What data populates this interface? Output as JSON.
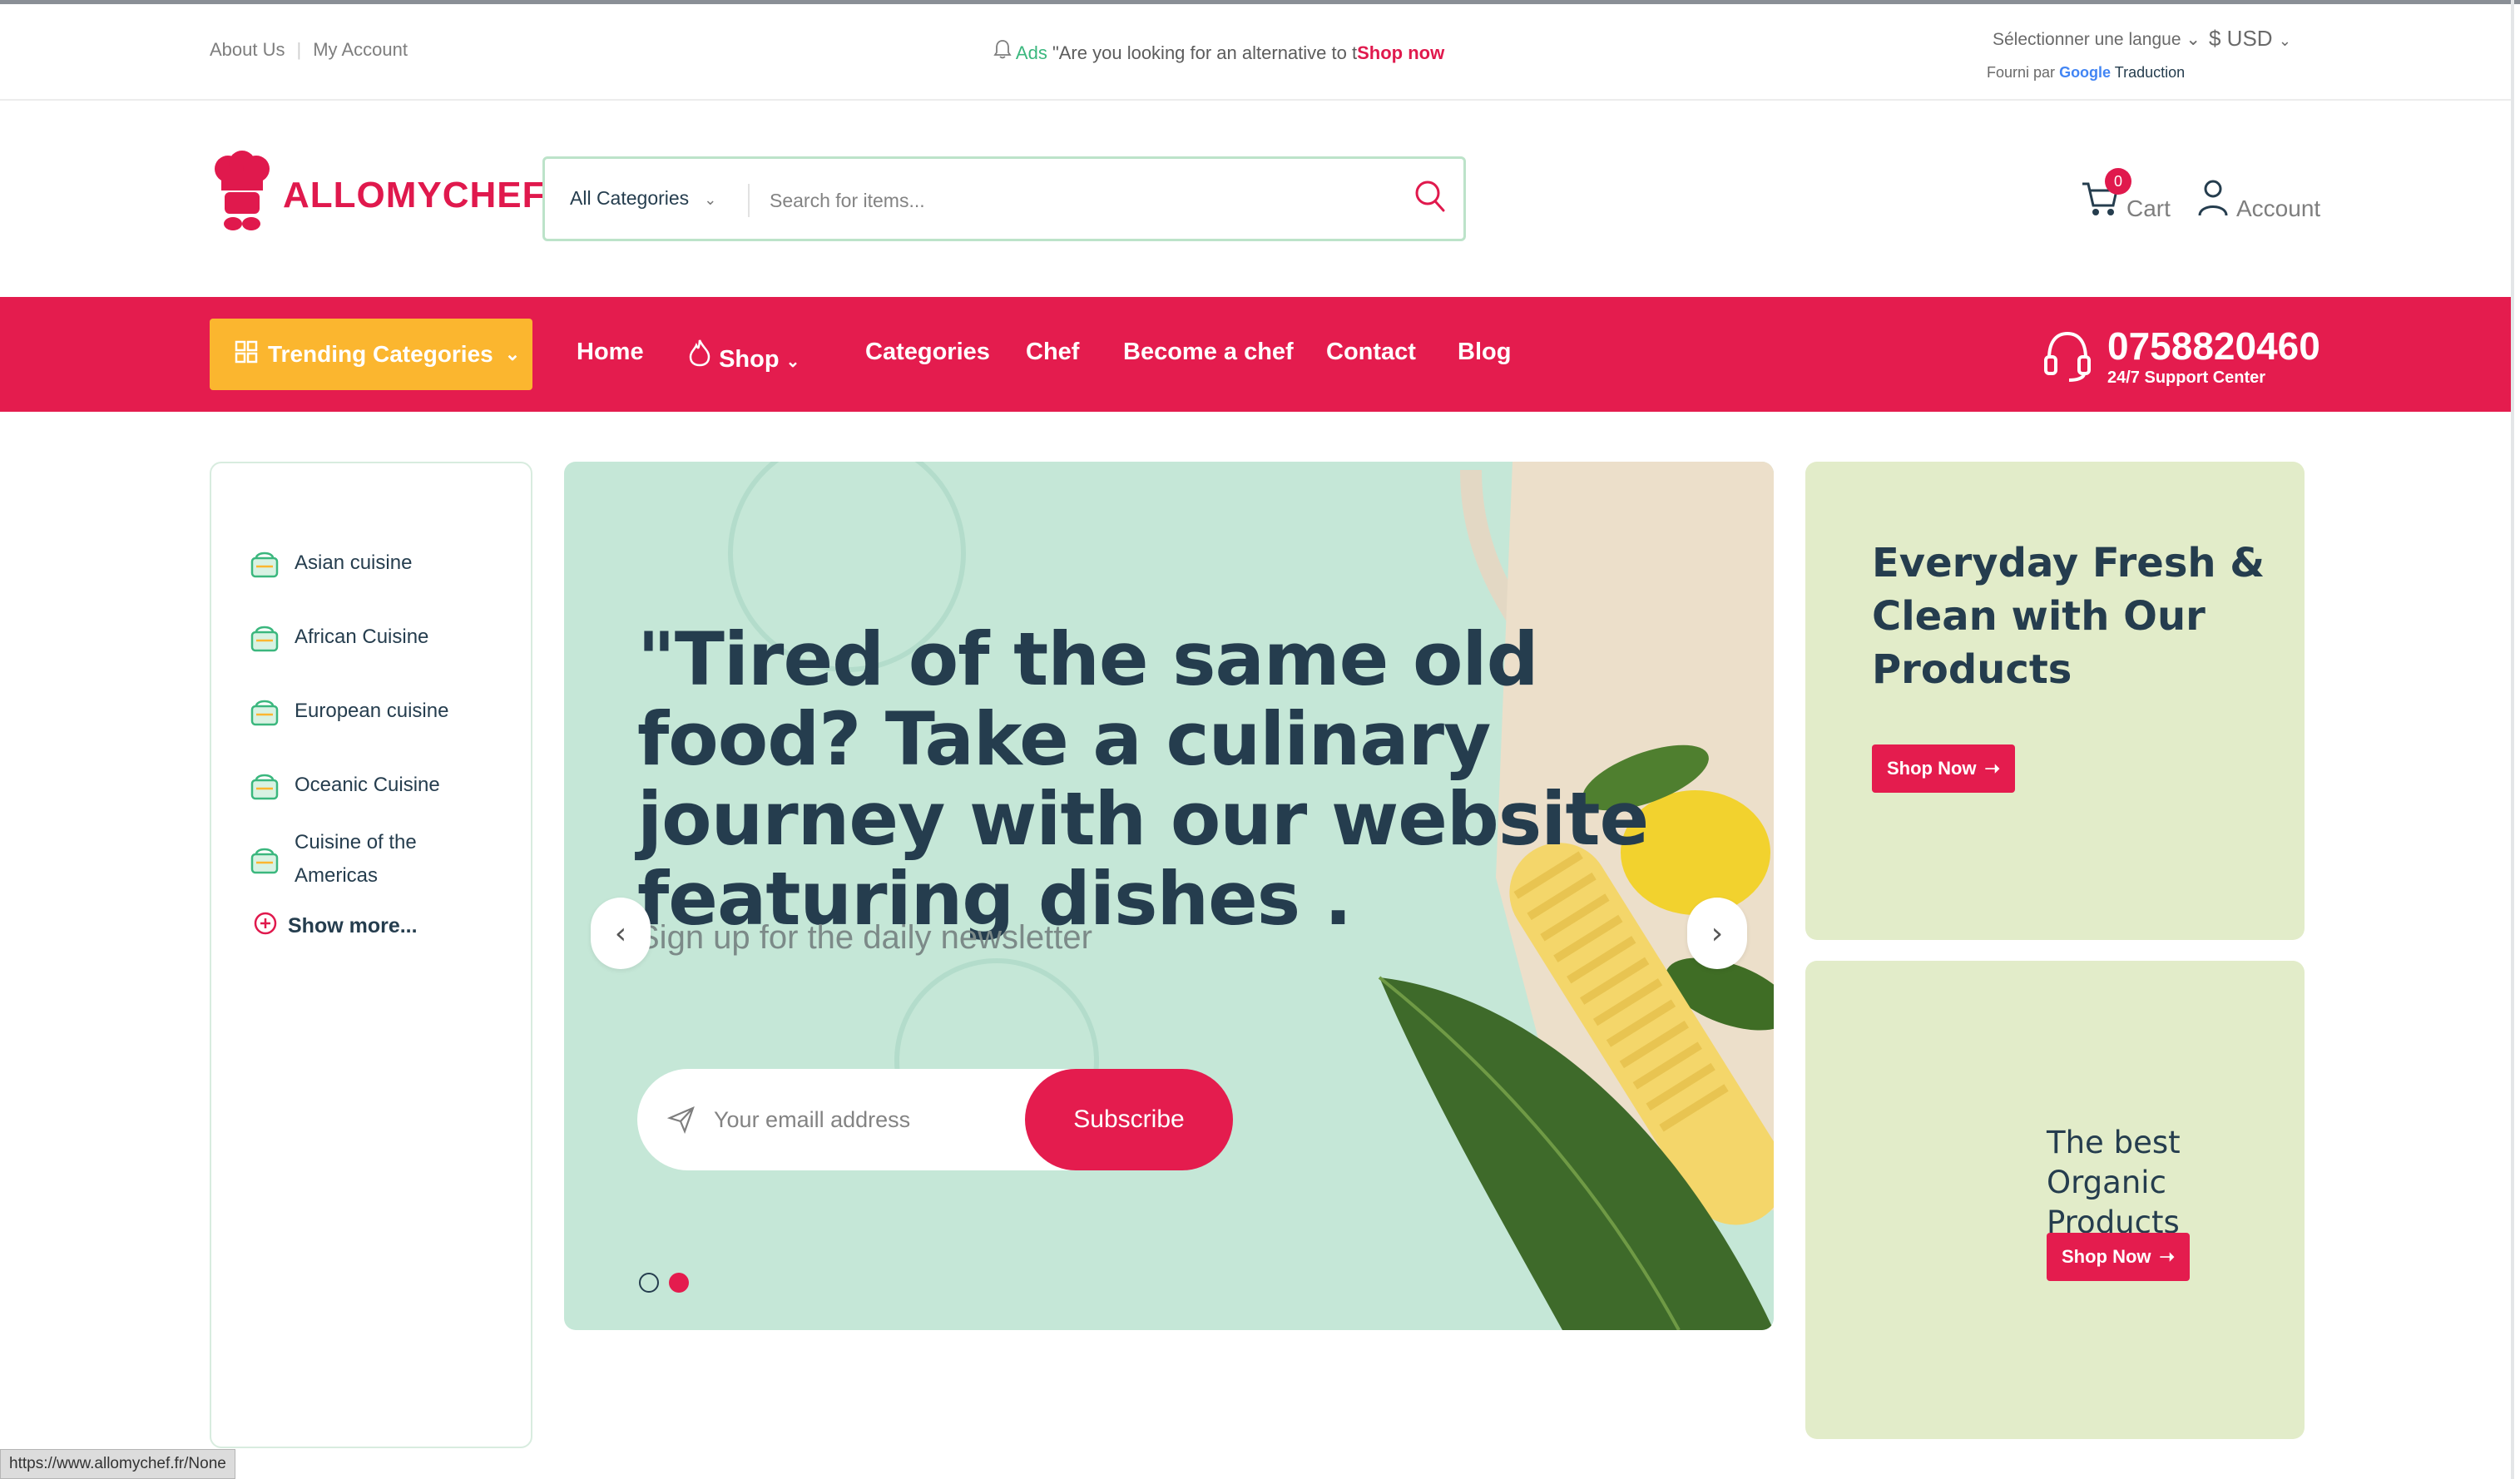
{
  "topbar": {
    "links": [
      "About Us",
      "My Account"
    ],
    "ads_label": "Ads",
    "ads_text": "\"Are you looking for an alternative to t",
    "ads_link": "Shop now",
    "language_select": "Sélectionner une langue",
    "currency": "$ USD",
    "powered_by": "Fourni par",
    "google": "Google",
    "translate": "Traduction"
  },
  "header": {
    "logo_text": "ALLOMYCHEF",
    "search_category": "All Categories",
    "search_placeholder": "Search for items...",
    "cart_count": "0",
    "cart_label": "Cart",
    "account_label": "Account"
  },
  "nav": {
    "trending_label": "Trending Categories",
    "items": [
      "Home",
      "Shop",
      "Categories",
      "Chef",
      "Become a chef",
      "Contact",
      "Blog"
    ],
    "phone": "0758820460",
    "support": "24/7 Support Center"
  },
  "sidebar": {
    "categories": [
      "Asian cuisine",
      "African Cuisine",
      "European cuisine",
      "Oceanic Cuisine",
      "Cuisine of the Americas"
    ],
    "show_more": "Show more..."
  },
  "hero": {
    "title": "\"Tired of the same old food? Take a culinary journey with our website featuring dishes .",
    "subtitle": "Sign up for the daily newsletter",
    "email_placeholder": "Your emaill address",
    "subscribe_label": "Subscribe",
    "slide_count": 2,
    "active_slide": 2
  },
  "promos": [
    {
      "title": "Everyday Fresh & Clean with Our Products",
      "button": "Shop Now"
    },
    {
      "title": "The best Organic Products Online",
      "button": "Shop Now"
    }
  ],
  "statusbar": {
    "url": "https://www.allomychef.fr/None"
  },
  "colors": {
    "primary": "#e41c4e",
    "accent": "#fbb62f",
    "green": "#3bb77e",
    "hero_bg": "#c5e7d7",
    "promo_bg": "#e2ecc9",
    "text": "#253d4e"
  },
  "icons": {
    "ads": "bell-icon",
    "search": "search-icon",
    "cart": "cart-icon",
    "account": "user-icon",
    "trending": "grid-icon",
    "shop": "flame-icon",
    "support": "headset-icon",
    "category": "food-basket-icon",
    "show_more": "plus-circle-icon",
    "email": "send-icon",
    "slider": [
      "chevron-left-icon",
      "chevron-right-icon"
    ]
  }
}
